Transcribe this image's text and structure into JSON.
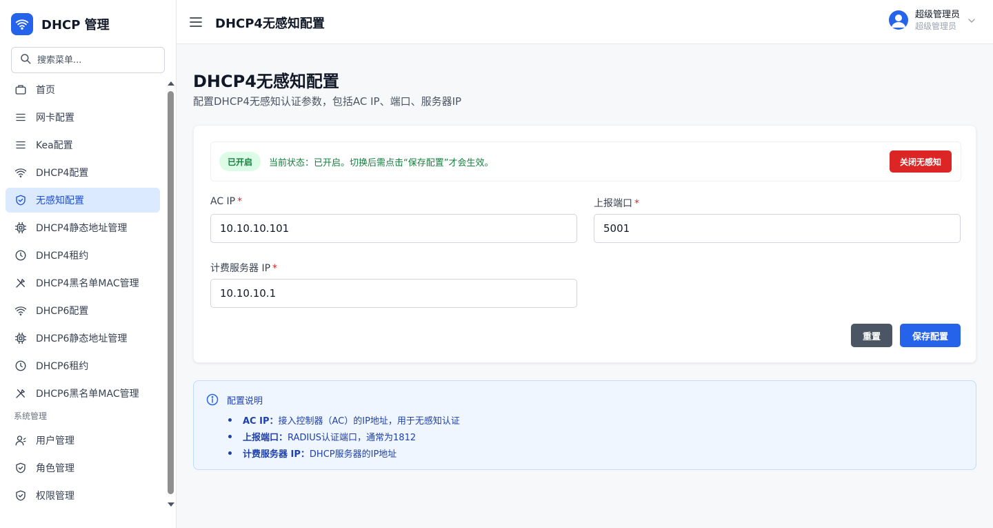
{
  "brand": {
    "title": "DHCP 管理"
  },
  "search": {
    "placeholder": "搜索菜单..."
  },
  "sidebar": {
    "items": [
      {
        "label": "首页",
        "icon": "home-icon"
      },
      {
        "label": "网卡配置",
        "icon": "list-icon"
      },
      {
        "label": "Kea配置",
        "icon": "list-icon"
      },
      {
        "label": "DHCP4配置",
        "icon": "wifi-icon"
      },
      {
        "label": "无感知配置",
        "icon": "shield-icon",
        "active": true
      },
      {
        "label": "DHCP4静态地址管理",
        "icon": "chip-icon"
      },
      {
        "label": "DHCP4租约",
        "icon": "clock-icon"
      },
      {
        "label": "DHCP4黑名单MAC管理",
        "icon": "tool-icon"
      },
      {
        "label": "DHCP6配置",
        "icon": "wifi-icon"
      },
      {
        "label": "DHCP6静态地址管理",
        "icon": "chip-icon"
      },
      {
        "label": "DHCP6租约",
        "icon": "clock-icon"
      },
      {
        "label": "DHCP6黑名单MAC管理",
        "icon": "tool-icon"
      }
    ],
    "section_title": "系统管理",
    "system_items": [
      {
        "label": "用户管理",
        "icon": "user-icon"
      },
      {
        "label": "角色管理",
        "icon": "shield-icon"
      },
      {
        "label": "权限管理",
        "icon": "shield-icon"
      }
    ]
  },
  "header": {
    "title": "DHCP4无感知配置",
    "user_name": "超级管理员",
    "user_role": "超级管理员"
  },
  "page": {
    "title": "DHCP4无感知配置",
    "subtitle": "配置DHCP4无感知认证参数，包括AC IP、端口、服务器IP"
  },
  "status": {
    "badge": "已开启",
    "text": "当前状态：已开启。切换后需点击“保存配置”才会生效。",
    "toggle_button": "关闭无感知"
  },
  "form": {
    "ac_ip": {
      "label": "AC IP",
      "value": "10.10.10.101"
    },
    "report_port": {
      "label": "上报端口",
      "value": "5001"
    },
    "accounting_ip": {
      "label": "计费服务器 IP",
      "value": "10.10.10.1"
    },
    "required_mark": "*",
    "reset_label": "重置",
    "save_label": "保存配置"
  },
  "info": {
    "title": "配置说明",
    "items": [
      {
        "key": "AC IP：",
        "text": "接入控制器（AC）的IP地址，用于无感知认证"
      },
      {
        "key": "上报端口：",
        "text": "RADIUS认证端口，通常为1812"
      },
      {
        "key": "计费服务器 IP：",
        "text": "DHCP服务器的IP地址"
      }
    ]
  },
  "colors": {
    "primary": "#2563eb",
    "danger": "#dc2626",
    "success": "#15803d",
    "active_bg": "#dbeafe"
  }
}
